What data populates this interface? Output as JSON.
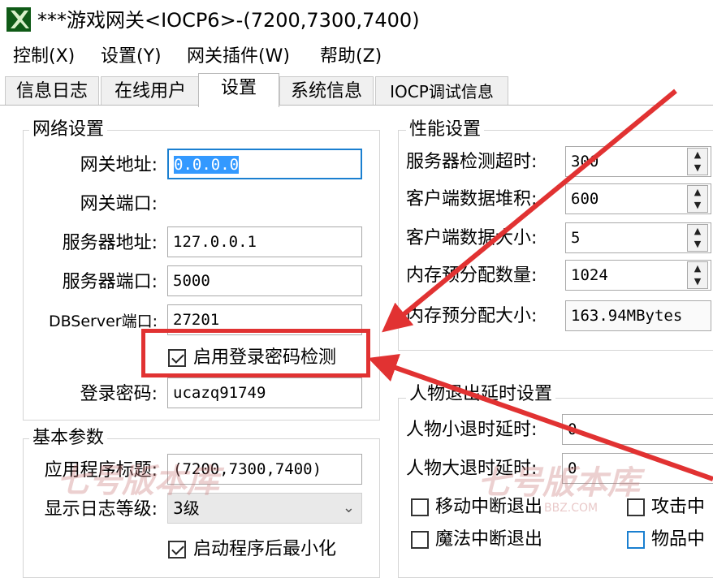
{
  "window": {
    "title": "***游戏网关<IOCP6>-(7200,7300,7400)"
  },
  "menu": [
    "控制(X)",
    "设置(Y)",
    "网关插件(W)",
    "帮助(Z)"
  ],
  "tabs": [
    "信息日志",
    "在线用户",
    "设置",
    "系统信息",
    "IOCP调试信息"
  ],
  "network": {
    "title": "网络设置",
    "gateway_addr_label": "网关地址:",
    "gateway_addr": "0.0.0.0",
    "gateway_port_label": "网关端口:",
    "server_addr_label": "服务器地址:",
    "server_addr": "127.0.0.1",
    "server_port_label": "服务器端口:",
    "server_port": "5000",
    "dbserver_port_label": "DBServer端口:",
    "dbserver_port": "27201",
    "enable_login_pwd_check": "启用登录密码检测",
    "login_pwd_label": "登录密码:",
    "login_pwd": "ucazq91749"
  },
  "basic": {
    "title": "基本参数",
    "app_title_label": "应用程序标题:",
    "app_title": "(7200,7300,7400)",
    "log_level_label": "显示日志等级:",
    "log_level": "3级",
    "minimize_on_start": "启动程序后最小化"
  },
  "performance": {
    "title": "性能设置",
    "server_timeout_label": "服务器检测超时:",
    "server_timeout": "300",
    "client_backlog_label": "客户端数据堆积:",
    "client_backlog": "600",
    "client_size_label": "客户端数据大小:",
    "client_size": "5",
    "mem_prealloc_count_label": "内存预分配数量:",
    "mem_prealloc_count": "1024",
    "mem_prealloc_size_label": "内存预分配大小:",
    "mem_prealloc_size": "163.94MBytes"
  },
  "exit_delay": {
    "title": "人物退出延时设置",
    "small_exit_label": "人物小退时延时:",
    "small_exit": "0",
    "big_exit_label": "人物大退时延时:",
    "big_exit": "0",
    "move_interrupt": "移动中断退出",
    "attack_interrupt": "攻击中",
    "magic_interrupt": "魔法中断退出",
    "item_interrupt": "物品中"
  },
  "watermark": {
    "text": "七号版本库",
    "sub": "BBZ.COM"
  },
  "colors": {
    "highlight": "#e13232",
    "selection": "#3399ff",
    "focus": "#1a7fd0"
  }
}
